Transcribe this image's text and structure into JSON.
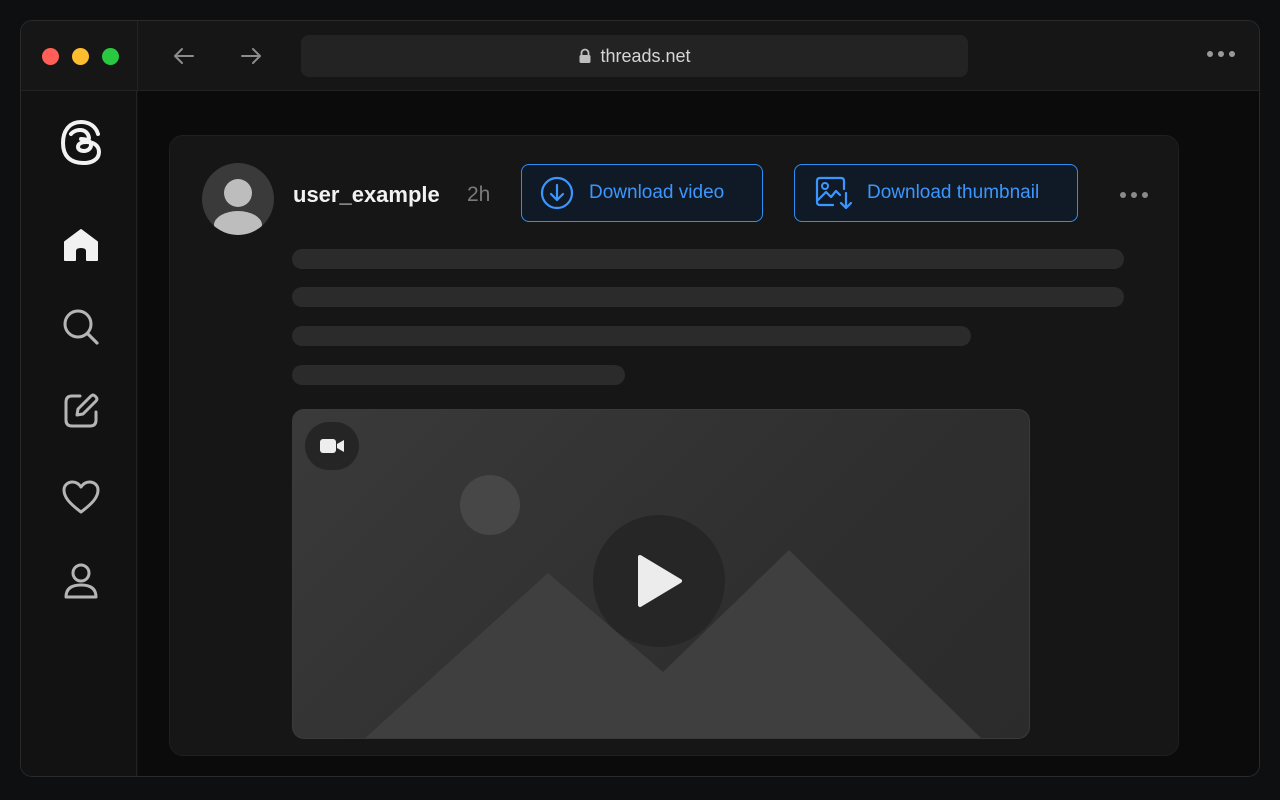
{
  "browser": {
    "address": "threads.net",
    "traffic_colors": {
      "close": "#ff5f57",
      "minimize": "#febc2e",
      "maximize": "#28c840"
    }
  },
  "sidebar": {
    "items": [
      {
        "name": "threads-logo-icon"
      },
      {
        "name": "home-icon",
        "active": true
      },
      {
        "name": "search-icon"
      },
      {
        "name": "compose-icon"
      },
      {
        "name": "heart-icon"
      },
      {
        "name": "profile-icon"
      }
    ]
  },
  "post": {
    "username": "user_example",
    "time": "2h",
    "download_video_label": "Download video",
    "download_thumbnail_label": "Download thumbnail",
    "media_type": "video"
  },
  "colors": {
    "accent": "#2f8df6",
    "background": "#0b0b0b",
    "card": "#161616"
  }
}
